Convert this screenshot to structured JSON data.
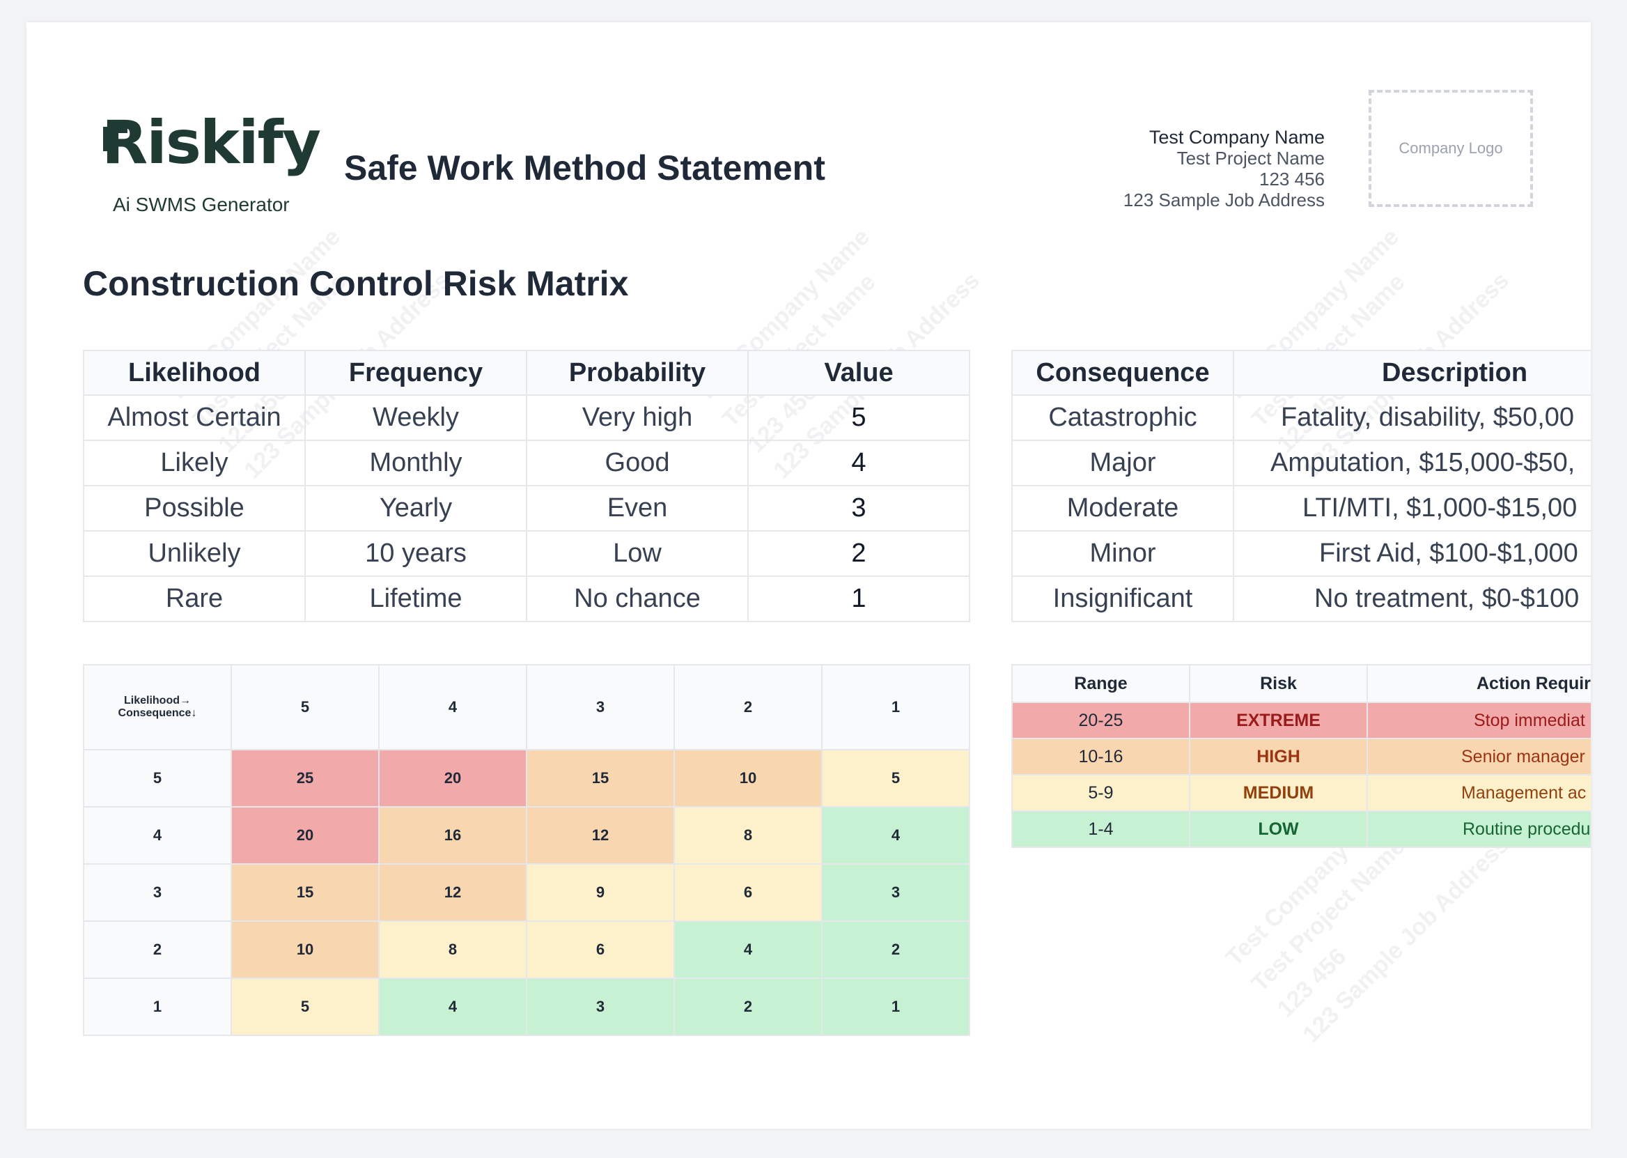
{
  "header": {
    "logo_text": "Riskify",
    "logo_subtitle": "Ai SWMS Generator",
    "document_title": "Safe Work Method Statement",
    "company_name": "Test Company Name",
    "project_name": "Test Project Name",
    "project_number": "123 456",
    "job_address": "123 Sample Job Address",
    "company_logo_placeholder": "Company Logo"
  },
  "watermark": {
    "lines": [
      "Test Company Name",
      "Test Project Name",
      "123 456",
      "123 Sample Job Address"
    ]
  },
  "section_title": "Construction Control Risk Matrix",
  "likelihood_table": {
    "headers": [
      "Likelihood",
      "Frequency",
      "Probability",
      "Value"
    ],
    "rows": [
      [
        "Almost Certain",
        "Weekly",
        "Very high",
        "5"
      ],
      [
        "Likely",
        "Monthly",
        "Good",
        "4"
      ],
      [
        "Possible",
        "Yearly",
        "Even",
        "3"
      ],
      [
        "Unlikely",
        "10 years",
        "Low",
        "2"
      ],
      [
        "Rare",
        "Lifetime",
        "No chance",
        "1"
      ]
    ]
  },
  "consequence_table": {
    "headers": [
      "Consequence",
      "Description"
    ],
    "rows": [
      [
        "Catastrophic",
        "Fatality, disability, $50,00"
      ],
      [
        "Major",
        "Amputation, $15,000-$50,"
      ],
      [
        "Moderate",
        "LTI/MTI, $1,000-$15,00"
      ],
      [
        "Minor",
        "First Aid, $100-$1,000"
      ],
      [
        "Insignificant",
        "No treatment, $0-$100"
      ]
    ]
  },
  "matrix": {
    "corner_line1": "Likelihood→",
    "corner_line2": "Consequence↓",
    "column_headers": [
      "5",
      "4",
      "3",
      "2",
      "1"
    ],
    "rows": [
      {
        "label": "5",
        "cells": [
          "25",
          "20",
          "15",
          "10",
          "5"
        ],
        "levels": [
          "ext",
          "ext",
          "high",
          "high",
          "med"
        ]
      },
      {
        "label": "4",
        "cells": [
          "20",
          "16",
          "12",
          "8",
          "4"
        ],
        "levels": [
          "ext",
          "high",
          "high",
          "med",
          "low"
        ]
      },
      {
        "label": "3",
        "cells": [
          "15",
          "12",
          "9",
          "6",
          "3"
        ],
        "levels": [
          "high",
          "high",
          "med",
          "med",
          "low"
        ]
      },
      {
        "label": "2",
        "cells": [
          "10",
          "8",
          "6",
          "4",
          "2"
        ],
        "levels": [
          "high",
          "med",
          "med",
          "low",
          "low"
        ]
      },
      {
        "label": "1",
        "cells": [
          "5",
          "4",
          "3",
          "2",
          "1"
        ],
        "levels": [
          "med",
          "low",
          "low",
          "low",
          "low"
        ]
      }
    ]
  },
  "range_table": {
    "headers": [
      "Range",
      "Risk",
      "Action Requir"
    ],
    "rows": [
      {
        "range": "20-25",
        "risk": "EXTREME",
        "action": "Stop immediat"
      },
      {
        "range": "10-16",
        "risk": "HIGH",
        "action": "Senior manager"
      },
      {
        "range": "5-9",
        "risk": "MEDIUM",
        "action": "Management ac"
      },
      {
        "range": "1-4",
        "risk": "LOW",
        "action": "Routine procedu"
      }
    ]
  },
  "colors": {
    "extreme": "#f2a9a9",
    "high": "#f8d6b0",
    "medium": "#fcf1cb",
    "low": "#c7f1d3",
    "brand": "#1e3a33"
  }
}
